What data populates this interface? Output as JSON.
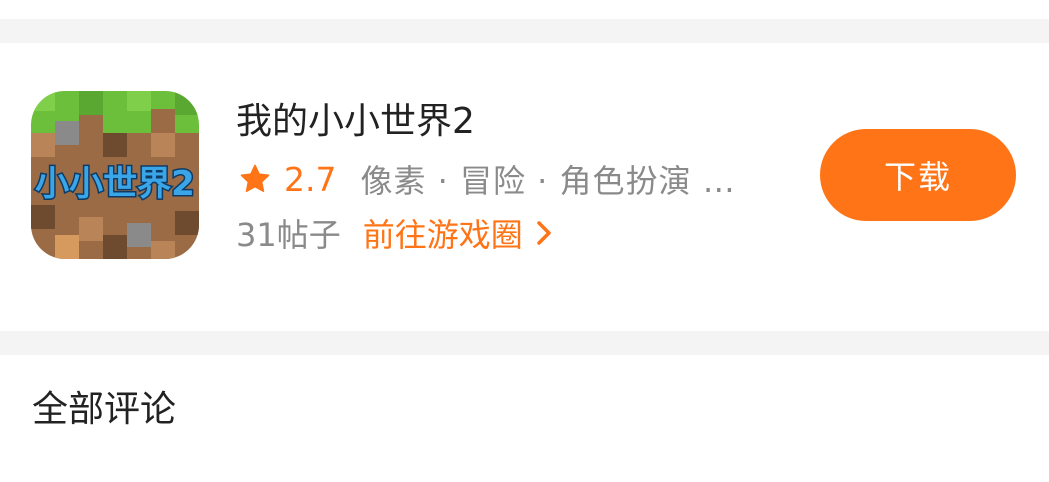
{
  "app": {
    "name": "我的小小世界2",
    "icon_text": "小小世界2",
    "rating": "2.7",
    "tags": "像素 · 冒险 · 角色扮演 …",
    "posts": "31帖子",
    "circle_link": "前往游戏圈",
    "download_label": "下载"
  },
  "section": {
    "title": "全部评论"
  },
  "colors": {
    "accent": "#ff7416",
    "divider": "#f4f4f4",
    "text_primary": "#222222",
    "text_secondary": "#8a8a8a"
  }
}
